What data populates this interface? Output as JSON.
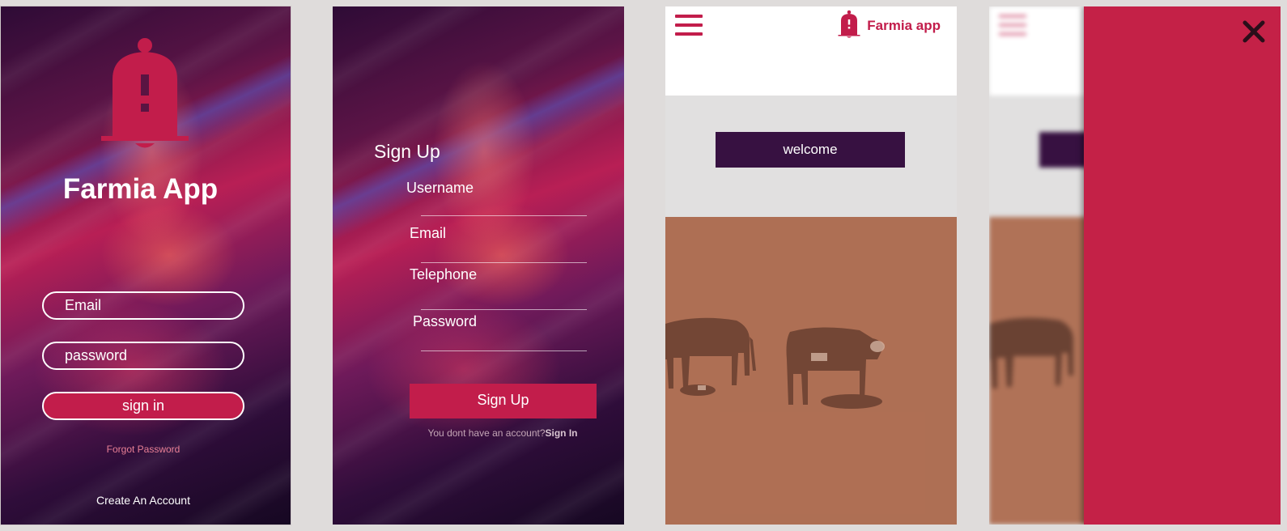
{
  "colors": {
    "accent": "#c21d4b",
    "menu_panel": "#c42147",
    "welcome_button": "#371141",
    "header_bg": "#ffffff",
    "screen_bg": "#e1e0e0",
    "photo_tint": "#ac7058"
  },
  "login": {
    "app_title": "Farmia App",
    "logo_icon": "bell-alert-icon",
    "email_placeholder": "Email",
    "password_placeholder": "password",
    "signin_label": "sign in",
    "forgot_label": "Forgot Password",
    "create_label": "Create An Account"
  },
  "signup": {
    "title": "Sign Up",
    "fields": {
      "username": "Username",
      "email": "Email",
      "telephone": "Telephone",
      "password": "Password"
    },
    "button_label": "Sign Up",
    "footer_text": "You dont have an account?",
    "footer_link": "Sign In"
  },
  "home": {
    "menu_icon": "hamburger-menu-icon",
    "brand_icon": "bell-alert-icon",
    "brand_name": "Farmia app",
    "welcome_label": "welcome",
    "photo_subject": "cows-grazing-photo"
  },
  "menu": {
    "close_icon": "close-icon"
  }
}
